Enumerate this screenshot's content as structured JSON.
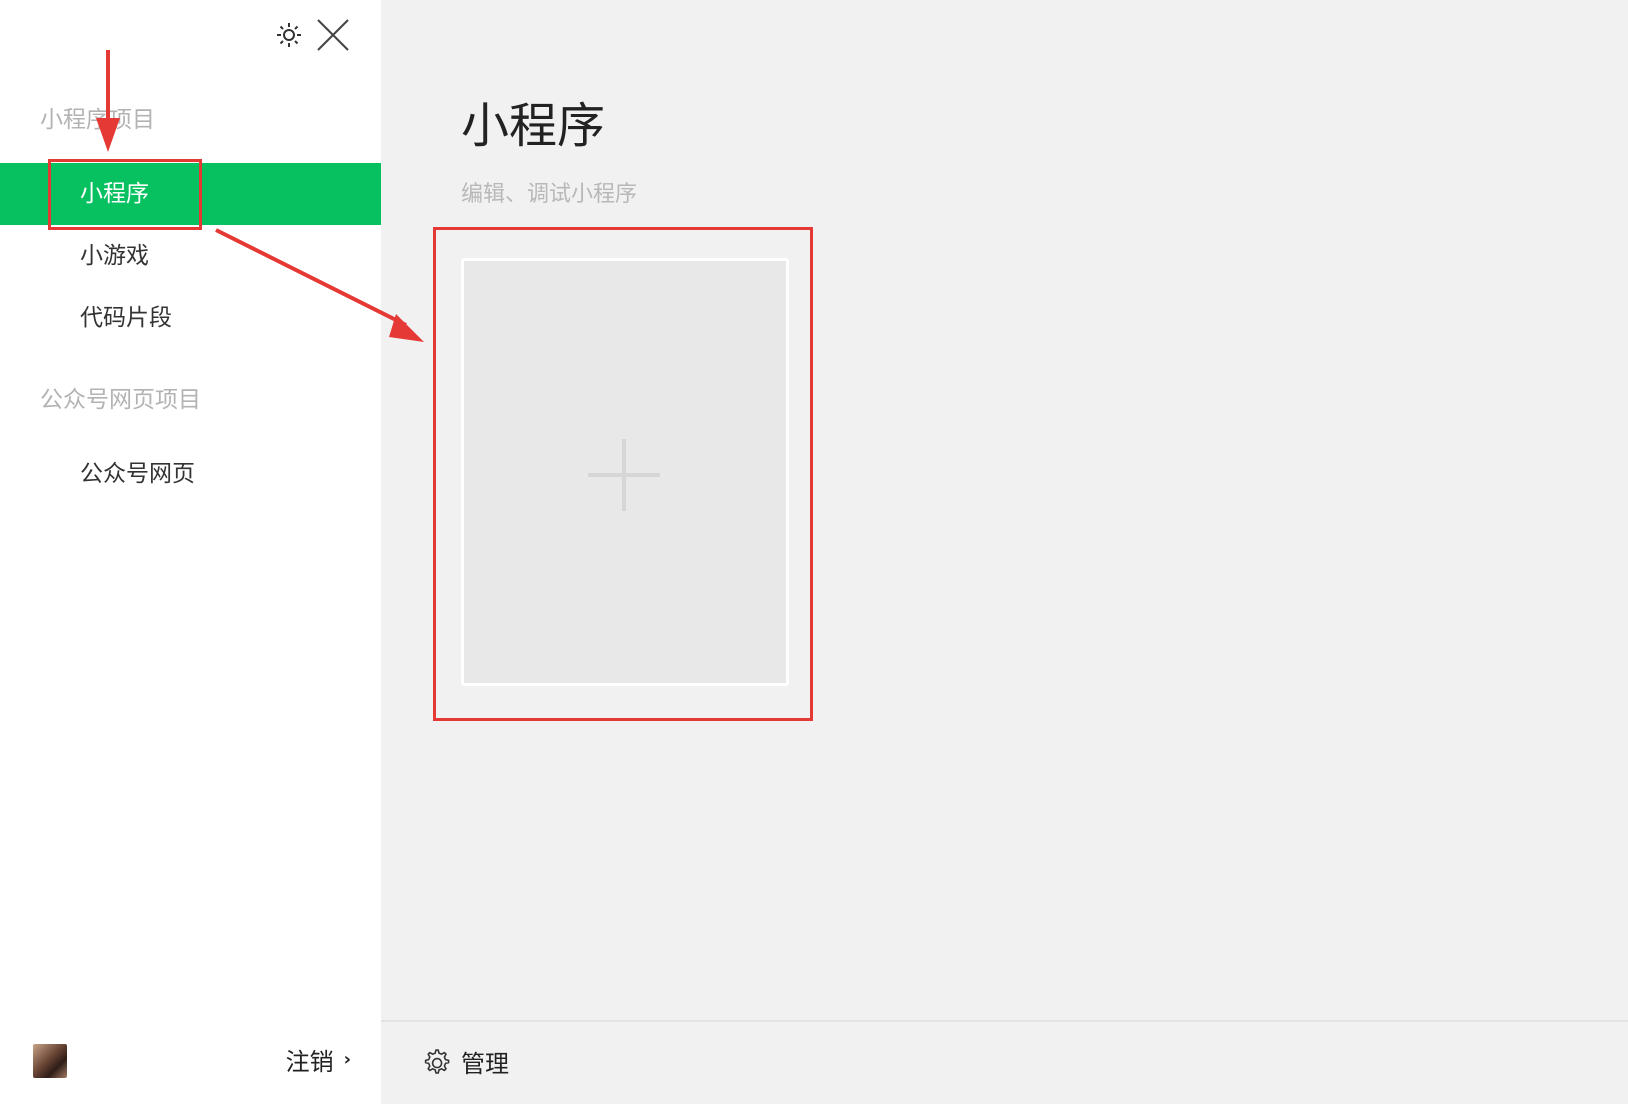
{
  "sidebar": {
    "section_miniprogram": "小程序项目",
    "items_mini": [
      "小程序",
      "小游戏",
      "代码片段"
    ],
    "section_official": "公众号网页项目",
    "items_official": [
      "公众号网页"
    ],
    "logout_label": "注销",
    "logout_chevron": "›"
  },
  "main": {
    "title": "小程序",
    "subtitle": "编辑、调试小程序",
    "manage_label": "管理"
  },
  "colors": {
    "accent": "#07c160",
    "annotation": "#e53935"
  },
  "icons": [
    "sun-icon",
    "close-icon",
    "plus-icon",
    "gear-icon",
    "avatar"
  ]
}
